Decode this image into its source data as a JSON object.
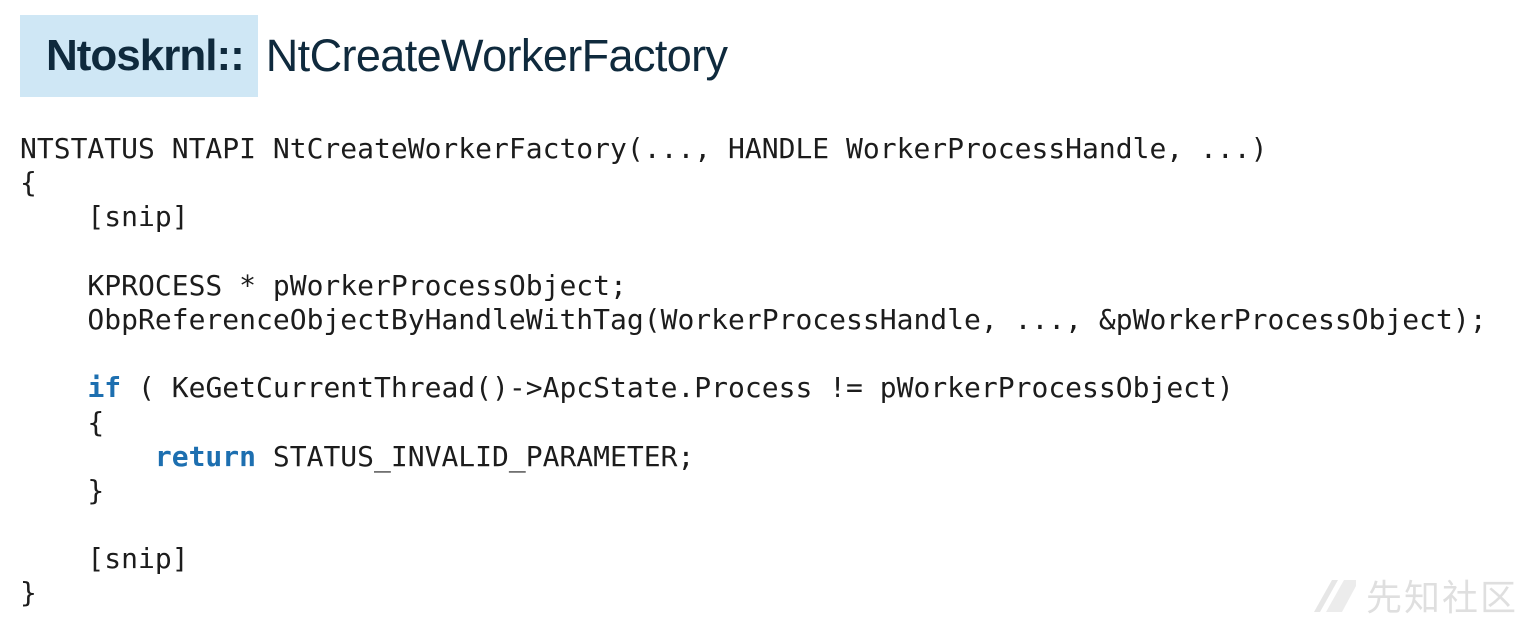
{
  "title": {
    "prefix": "Ntoskrnl::",
    "name": "NtCreateWorkerFactory"
  },
  "code": {
    "lines": [
      [
        {
          "text": "NTSTATUS NTAPI NtCreateWorkerFactory(..., HANDLE WorkerProcessHandle, ...)"
        }
      ],
      [
        {
          "text": "{"
        }
      ],
      [
        {
          "text": "    [snip]"
        }
      ],
      [
        {
          "text": ""
        }
      ],
      [
        {
          "text": "    KPROCESS * pWorkerProcessObject;"
        }
      ],
      [
        {
          "text": "    ObpReferenceObjectByHandleWithTag(WorkerProcessHandle, ..., &pWorkerProcessObject);"
        }
      ],
      [
        {
          "text": ""
        }
      ],
      [
        {
          "text": "    "
        },
        {
          "text": "if",
          "kw": true
        },
        {
          "text": " ( KeGetCurrentThread()->ApcState.Process != pWorkerProcessObject)"
        }
      ],
      [
        {
          "text": "    {"
        }
      ],
      [
        {
          "text": "        "
        },
        {
          "text": "return",
          "kw": true
        },
        {
          "text": " STATUS_INVALID_PARAMETER;"
        }
      ],
      [
        {
          "text": "    }"
        }
      ],
      [
        {
          "text": ""
        }
      ],
      [
        {
          "text": "    [snip]"
        }
      ],
      [
        {
          "text": "}"
        }
      ]
    ]
  },
  "watermark": {
    "text": "先知社区"
  },
  "colors": {
    "title_highlight": "#cfe7f5",
    "title_text": "#0f2a3d",
    "keyword": "#1d6fb0",
    "code_text": "#1c1c1c"
  }
}
